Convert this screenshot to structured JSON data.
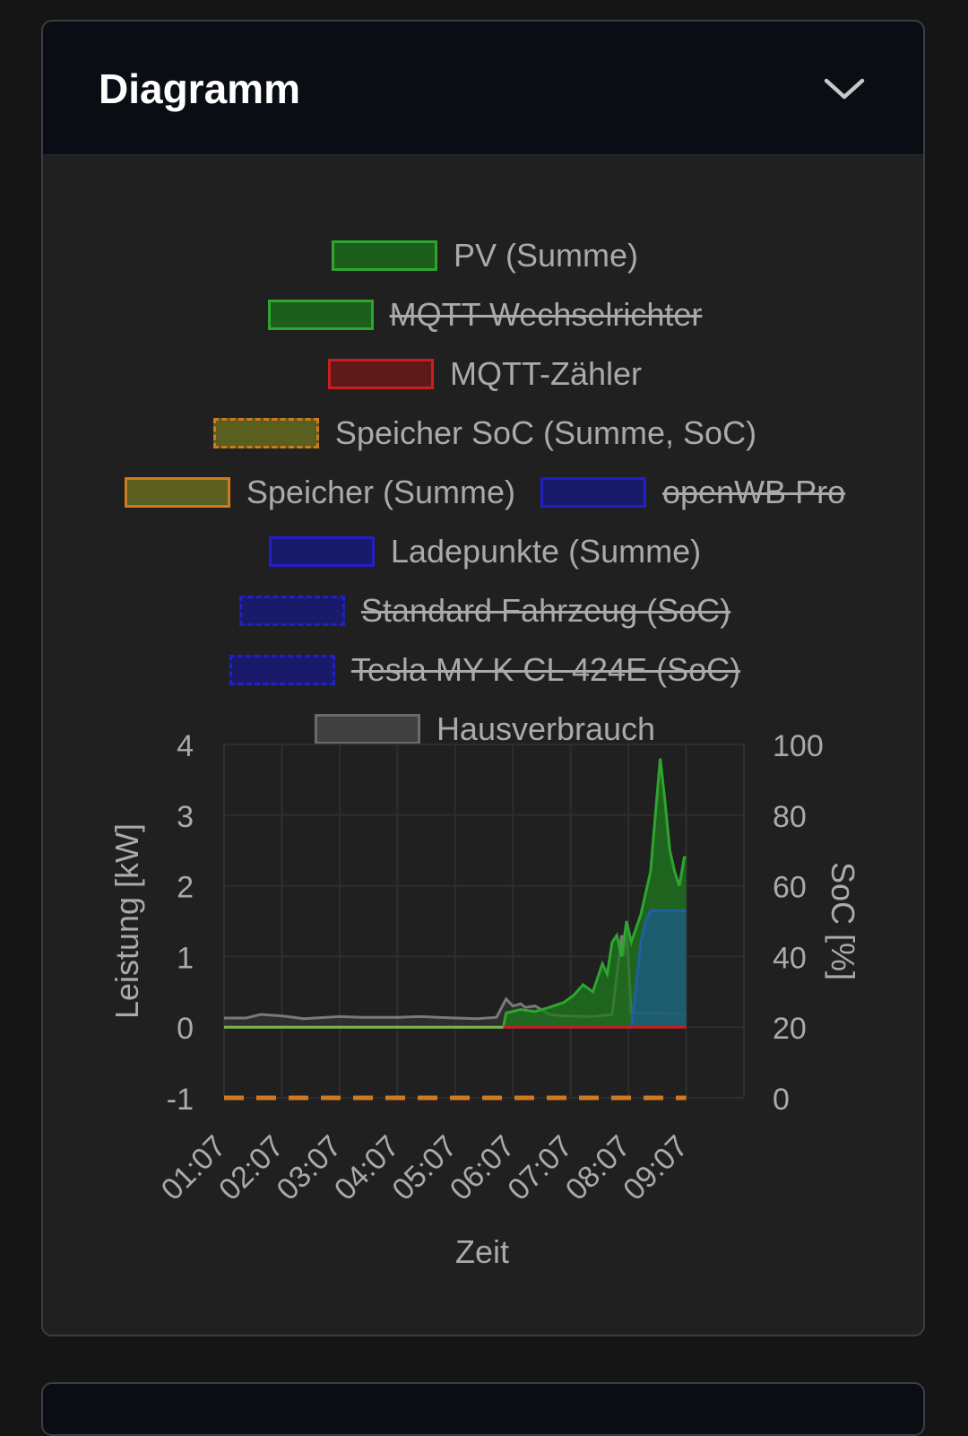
{
  "card": {
    "title": "Diagramm"
  },
  "legend": [
    [
      {
        "label": "PV (Summe)",
        "fill": "#1c5e1c",
        "stroke": "#2ea52e",
        "dash": false,
        "hidden": false
      }
    ],
    [
      {
        "label": "MQTT Wechselrichter",
        "fill": "#1c5e1c",
        "stroke": "#2ea52e",
        "dash": false,
        "hidden": true
      }
    ],
    [
      {
        "label": "MQTT-Zähler",
        "fill": "#5e1a1a",
        "stroke": "#c81e1e",
        "dash": false,
        "hidden": false
      }
    ],
    [
      {
        "label": "Speicher SoC (Summe, SoC)",
        "fill": "#5a5e1e",
        "stroke": "#d07a20",
        "dash": true,
        "hidden": false
      }
    ],
    [
      {
        "label": "Speicher (Summe)",
        "fill": "#5a5e1e",
        "stroke": "#d07a20",
        "dash": false,
        "hidden": false
      },
      {
        "label": "openWB Pro",
        "fill": "#1a1a6a",
        "stroke": "#2020c8",
        "dash": false,
        "hidden": true
      }
    ],
    [
      {
        "label": "Ladepunkte (Summe)",
        "fill": "#1a1a6a",
        "stroke": "#2020c8",
        "dash": false,
        "hidden": false
      }
    ],
    [
      {
        "label": "Standard Fahrzeug (SoC)",
        "fill": "#1a1a6a",
        "stroke": "#2020c8",
        "dash": true,
        "hidden": true
      }
    ],
    [
      {
        "label": "Tesla MY K CL 424E (SoC)",
        "fill": "#1a1a6a",
        "stroke": "#2020c8",
        "dash": true,
        "hidden": true
      }
    ],
    [
      {
        "label": "Hausverbrauch",
        "fill": "#404040",
        "stroke": "#6a6a6a",
        "dash": false,
        "hidden": false
      }
    ]
  ],
  "chart_data": {
    "type": "area",
    "xlabel": "Zeit",
    "ylabel": "Leistung [kW]",
    "y2label": "SoC [%]",
    "ylim": [
      -1,
      4
    ],
    "y2lim": [
      0,
      100
    ],
    "yticks": [
      "4",
      "3",
      "2",
      "1",
      "0",
      "-1"
    ],
    "y2ticks": [
      "100",
      "80",
      "60",
      "40",
      "20",
      "0"
    ],
    "xticks": [
      "01:07",
      "02:07",
      "03:07",
      "04:07",
      "05:07",
      "06:07",
      "07:07",
      "08:07",
      "09:07"
    ],
    "grid": true,
    "legend_position": "top",
    "colors": {
      "pv": "#2ea52e",
      "house": "#7a7a7a",
      "grid_meter": "#c81e1e",
      "battery": "#d07a20",
      "chargepoints": "#2060a0"
    },
    "series": [
      {
        "name": "PV (Summe)",
        "x": [
          "01:07",
          "05:57",
          "06:00",
          "06:15",
          "06:30",
          "06:45",
          "07:00",
          "07:10",
          "07:20",
          "07:30",
          "07:40",
          "07:45",
          "07:50",
          "07:55",
          "08:00",
          "08:05",
          "08:10",
          "08:20",
          "08:30",
          "08:35",
          "08:40",
          "08:45",
          "08:50",
          "08:55",
          "09:00",
          "09:05",
          "09:07"
        ],
        "y": [
          0,
          0,
          0.2,
          0.25,
          0.22,
          0.28,
          0.35,
          0.45,
          0.6,
          0.5,
          0.9,
          0.75,
          1.2,
          1.3,
          1.0,
          1.5,
          1.2,
          1.6,
          2.2,
          3.0,
          3.8,
          3.2,
          2.5,
          2.2,
          2.0,
          2.4,
          2.4
        ]
      },
      {
        "name": "MQTT-Zähler",
        "x": [
          "05:57",
          "09:07"
        ],
        "y": [
          0,
          0
        ]
      },
      {
        "name": "Speicher SoC (Summe, SoC)",
        "x": [
          "01:07",
          "09:07"
        ],
        "y": [
          0,
          0
        ],
        "axis": "y2"
      },
      {
        "name": "Ladepunkte (Summe)",
        "x": [
          "01:07",
          "08:07",
          "08:10",
          "08:15",
          "08:20",
          "08:25",
          "08:30",
          "09:07"
        ],
        "y": [
          0,
          0,
          0,
          0.6,
          1.2,
          1.5,
          1.65,
          1.65
        ]
      },
      {
        "name": "Hausverbrauch",
        "x": [
          "01:07",
          "01:30",
          "01:45",
          "02:07",
          "02:30",
          "03:07",
          "03:30",
          "04:07",
          "04:30",
          "05:07",
          "05:30",
          "05:50",
          "06:00",
          "06:07",
          "06:15",
          "06:20",
          "06:30",
          "06:45",
          "07:00",
          "07:30",
          "07:50",
          "08:00",
          "08:02",
          "08:05",
          "08:10",
          "08:30",
          "09:07"
        ],
        "y": [
          0.13,
          0.13,
          0.18,
          0.16,
          0.12,
          0.15,
          0.14,
          0.14,
          0.15,
          0.13,
          0.12,
          0.14,
          0.4,
          0.3,
          0.33,
          0.28,
          0.3,
          0.18,
          0.16,
          0.15,
          0.18,
          1.3,
          1.0,
          1.4,
          0.2,
          0.2,
          0.18
        ]
      }
    ]
  }
}
